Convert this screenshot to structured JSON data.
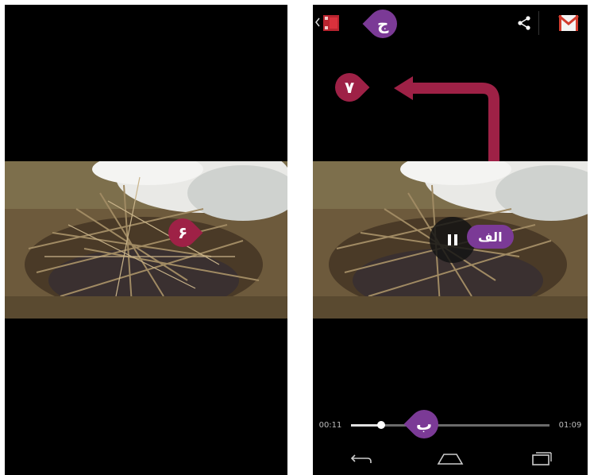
{
  "left_screen": {
    "callout_label": "۶"
  },
  "right_screen": {
    "top_callout": "ج",
    "arrow_callout": "۷",
    "pause_callout": "الف",
    "seek_callout": "ب",
    "current_time": "00:11",
    "total_time": "01:09",
    "progress_fraction": 0.15
  },
  "colors": {
    "maroon": "#9e2146",
    "purple": "#7b3a96",
    "background": "#000000"
  },
  "icons": {
    "back_caret": "back-caret-icon",
    "app_thumbnail": "video-app-icon",
    "share": "share-icon",
    "gmail": "gmail-icon",
    "pause": "pause-icon",
    "nav_back": "nav-back-icon",
    "nav_home": "nav-home-icon",
    "nav_recents": "nav-recents-icon"
  }
}
